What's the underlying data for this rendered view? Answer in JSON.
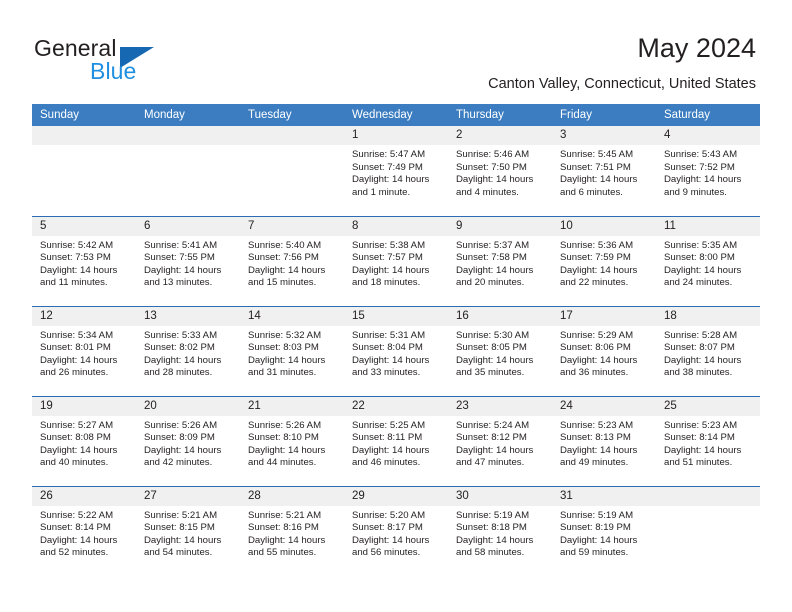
{
  "brand": {
    "name_dark": "General",
    "name_light": "Blue",
    "icon": "triangle-logo-mark"
  },
  "header": {
    "title": "May 2024",
    "subtitle": "Canton Valley, Connecticut, United States"
  },
  "colors": {
    "header_blue": "#3b7dc0",
    "row_divider_blue": "#2a6db5",
    "daynum_band": "#f0f0f0",
    "logo_blue": "#1668b3",
    "logo_text_blue": "#1f8fe0",
    "text": "#231f20"
  },
  "calendar": {
    "weekday_headers": [
      "Sunday",
      "Monday",
      "Tuesday",
      "Wednesday",
      "Thursday",
      "Friday",
      "Saturday"
    ],
    "weeks": [
      [
        {
          "day": "",
          "blank": true
        },
        {
          "day": "",
          "blank": true
        },
        {
          "day": "",
          "blank": true
        },
        {
          "day": "1",
          "sunrise": "Sunrise: 5:47 AM",
          "sunset": "Sunset: 7:49 PM",
          "daylight_1": "Daylight: 14 hours",
          "daylight_2": "and 1 minute."
        },
        {
          "day": "2",
          "sunrise": "Sunrise: 5:46 AM",
          "sunset": "Sunset: 7:50 PM",
          "daylight_1": "Daylight: 14 hours",
          "daylight_2": "and 4 minutes."
        },
        {
          "day": "3",
          "sunrise": "Sunrise: 5:45 AM",
          "sunset": "Sunset: 7:51 PM",
          "daylight_1": "Daylight: 14 hours",
          "daylight_2": "and 6 minutes."
        },
        {
          "day": "4",
          "sunrise": "Sunrise: 5:43 AM",
          "sunset": "Sunset: 7:52 PM",
          "daylight_1": "Daylight: 14 hours",
          "daylight_2": "and 9 minutes."
        }
      ],
      [
        {
          "day": "5",
          "sunrise": "Sunrise: 5:42 AM",
          "sunset": "Sunset: 7:53 PM",
          "daylight_1": "Daylight: 14 hours",
          "daylight_2": "and 11 minutes."
        },
        {
          "day": "6",
          "sunrise": "Sunrise: 5:41 AM",
          "sunset": "Sunset: 7:55 PM",
          "daylight_1": "Daylight: 14 hours",
          "daylight_2": "and 13 minutes."
        },
        {
          "day": "7",
          "sunrise": "Sunrise: 5:40 AM",
          "sunset": "Sunset: 7:56 PM",
          "daylight_1": "Daylight: 14 hours",
          "daylight_2": "and 15 minutes."
        },
        {
          "day": "8",
          "sunrise": "Sunrise: 5:38 AM",
          "sunset": "Sunset: 7:57 PM",
          "daylight_1": "Daylight: 14 hours",
          "daylight_2": "and 18 minutes."
        },
        {
          "day": "9",
          "sunrise": "Sunrise: 5:37 AM",
          "sunset": "Sunset: 7:58 PM",
          "daylight_1": "Daylight: 14 hours",
          "daylight_2": "and 20 minutes."
        },
        {
          "day": "10",
          "sunrise": "Sunrise: 5:36 AM",
          "sunset": "Sunset: 7:59 PM",
          "daylight_1": "Daylight: 14 hours",
          "daylight_2": "and 22 minutes."
        },
        {
          "day": "11",
          "sunrise": "Sunrise: 5:35 AM",
          "sunset": "Sunset: 8:00 PM",
          "daylight_1": "Daylight: 14 hours",
          "daylight_2": "and 24 minutes."
        }
      ],
      [
        {
          "day": "12",
          "sunrise": "Sunrise: 5:34 AM",
          "sunset": "Sunset: 8:01 PM",
          "daylight_1": "Daylight: 14 hours",
          "daylight_2": "and 26 minutes."
        },
        {
          "day": "13",
          "sunrise": "Sunrise: 5:33 AM",
          "sunset": "Sunset: 8:02 PM",
          "daylight_1": "Daylight: 14 hours",
          "daylight_2": "and 28 minutes."
        },
        {
          "day": "14",
          "sunrise": "Sunrise: 5:32 AM",
          "sunset": "Sunset: 8:03 PM",
          "daylight_1": "Daylight: 14 hours",
          "daylight_2": "and 31 minutes."
        },
        {
          "day": "15",
          "sunrise": "Sunrise: 5:31 AM",
          "sunset": "Sunset: 8:04 PM",
          "daylight_1": "Daylight: 14 hours",
          "daylight_2": "and 33 minutes."
        },
        {
          "day": "16",
          "sunrise": "Sunrise: 5:30 AM",
          "sunset": "Sunset: 8:05 PM",
          "daylight_1": "Daylight: 14 hours",
          "daylight_2": "and 35 minutes."
        },
        {
          "day": "17",
          "sunrise": "Sunrise: 5:29 AM",
          "sunset": "Sunset: 8:06 PM",
          "daylight_1": "Daylight: 14 hours",
          "daylight_2": "and 36 minutes."
        },
        {
          "day": "18",
          "sunrise": "Sunrise: 5:28 AM",
          "sunset": "Sunset: 8:07 PM",
          "daylight_1": "Daylight: 14 hours",
          "daylight_2": "and 38 minutes."
        }
      ],
      [
        {
          "day": "19",
          "sunrise": "Sunrise: 5:27 AM",
          "sunset": "Sunset: 8:08 PM",
          "daylight_1": "Daylight: 14 hours",
          "daylight_2": "and 40 minutes."
        },
        {
          "day": "20",
          "sunrise": "Sunrise: 5:26 AM",
          "sunset": "Sunset: 8:09 PM",
          "daylight_1": "Daylight: 14 hours",
          "daylight_2": "and 42 minutes."
        },
        {
          "day": "21",
          "sunrise": "Sunrise: 5:26 AM",
          "sunset": "Sunset: 8:10 PM",
          "daylight_1": "Daylight: 14 hours",
          "daylight_2": "and 44 minutes."
        },
        {
          "day": "22",
          "sunrise": "Sunrise: 5:25 AM",
          "sunset": "Sunset: 8:11 PM",
          "daylight_1": "Daylight: 14 hours",
          "daylight_2": "and 46 minutes."
        },
        {
          "day": "23",
          "sunrise": "Sunrise: 5:24 AM",
          "sunset": "Sunset: 8:12 PM",
          "daylight_1": "Daylight: 14 hours",
          "daylight_2": "and 47 minutes."
        },
        {
          "day": "24",
          "sunrise": "Sunrise: 5:23 AM",
          "sunset": "Sunset: 8:13 PM",
          "daylight_1": "Daylight: 14 hours",
          "daylight_2": "and 49 minutes."
        },
        {
          "day": "25",
          "sunrise": "Sunrise: 5:23 AM",
          "sunset": "Sunset: 8:14 PM",
          "daylight_1": "Daylight: 14 hours",
          "daylight_2": "and 51 minutes."
        }
      ],
      [
        {
          "day": "26",
          "sunrise": "Sunrise: 5:22 AM",
          "sunset": "Sunset: 8:14 PM",
          "daylight_1": "Daylight: 14 hours",
          "daylight_2": "and 52 minutes."
        },
        {
          "day": "27",
          "sunrise": "Sunrise: 5:21 AM",
          "sunset": "Sunset: 8:15 PM",
          "daylight_1": "Daylight: 14 hours",
          "daylight_2": "and 54 minutes."
        },
        {
          "day": "28",
          "sunrise": "Sunrise: 5:21 AM",
          "sunset": "Sunset: 8:16 PM",
          "daylight_1": "Daylight: 14 hours",
          "daylight_2": "and 55 minutes."
        },
        {
          "day": "29",
          "sunrise": "Sunrise: 5:20 AM",
          "sunset": "Sunset: 8:17 PM",
          "daylight_1": "Daylight: 14 hours",
          "daylight_2": "and 56 minutes."
        },
        {
          "day": "30",
          "sunrise": "Sunrise: 5:19 AM",
          "sunset": "Sunset: 8:18 PM",
          "daylight_1": "Daylight: 14 hours",
          "daylight_2": "and 58 minutes."
        },
        {
          "day": "31",
          "sunrise": "Sunrise: 5:19 AM",
          "sunset": "Sunset: 8:19 PM",
          "daylight_1": "Daylight: 14 hours",
          "daylight_2": "and 59 minutes."
        },
        {
          "day": "",
          "blank": true
        }
      ]
    ]
  }
}
